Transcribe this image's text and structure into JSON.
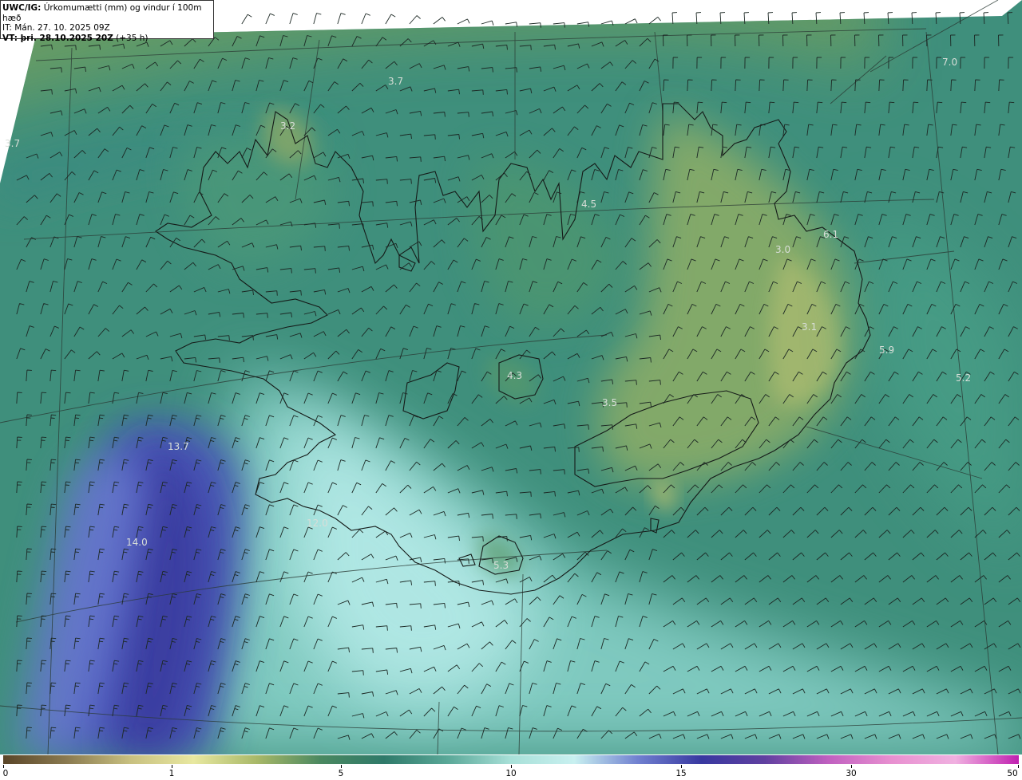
{
  "header": {
    "line1_prefix": "UWC/IG:",
    "line1_rest": " Úrkomumætti (mm) og vindur í 100m hæð",
    "line2": "IT: Mán. 27. 10. 2025 09Z",
    "line3_prefix": "VT:",
    "line3_bold": " þri. 28.10.2025 20Z",
    "line3_rest": " (+35 h)"
  },
  "map_labels": [
    "3.7",
    "3.2",
    "3.7",
    "4.5",
    "7.0",
    "6.1",
    "3.0",
    "3.1",
    "5.9",
    "5.2",
    "4.3",
    "3.5",
    "13.7",
    "12.0",
    "14.0",
    "5.3"
  ],
  "colorbar": {
    "ticks": [
      "0",
      "1",
      "5",
      "10",
      "15",
      "30",
      "50"
    ],
    "colors": [
      "#5a4528",
      "#8a7a50",
      "#c8c080",
      "#e8e8a0",
      "#a8b868",
      "#4a8860",
      "#2f7a6a",
      "#5aa898",
      "#a8e0d8",
      "#c8f0f0",
      "#7080d0",
      "#3838a0",
      "#6040a0",
      "#c060c0",
      "#e890d0",
      "#f0b0e0",
      "#c020b0"
    ]
  },
  "colors": {
    "ocean": "#4a9a88",
    "land": "#3f8a70",
    "high_precip": "#4a58b8",
    "mid_precip": "#a8e6e0",
    "low_precip": "#7da866"
  }
}
